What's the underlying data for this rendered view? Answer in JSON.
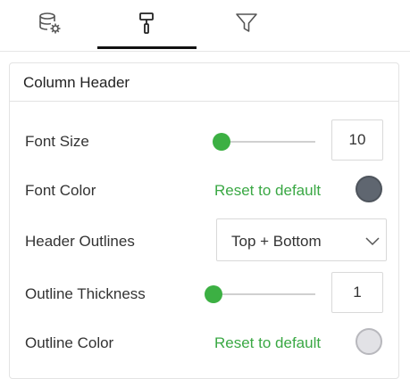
{
  "tabs": [
    {
      "icon": "database-settings-icon",
      "active": false
    },
    {
      "icon": "paint-roller-icon",
      "active": true
    },
    {
      "icon": "filter-icon",
      "active": false
    }
  ],
  "panel": {
    "title": "Column Header",
    "font_size": {
      "label": "Font Size",
      "value": "10",
      "slider_fraction": 0.0
    },
    "font_color": {
      "label": "Font Color",
      "reset_label": "Reset to default",
      "color": "#5f6670"
    },
    "header_outlines": {
      "label": "Header Outlines",
      "value": "Top + Bottom"
    },
    "outline_thickness": {
      "label": "Outline Thickness",
      "value": "1",
      "slider_fraction": 0.0
    },
    "outline_color": {
      "label": "Outline Color",
      "reset_label": "Reset to default",
      "color": "#e2e2e6"
    }
  },
  "colors": {
    "accent": "#3cb043",
    "link": "#3aa844"
  }
}
